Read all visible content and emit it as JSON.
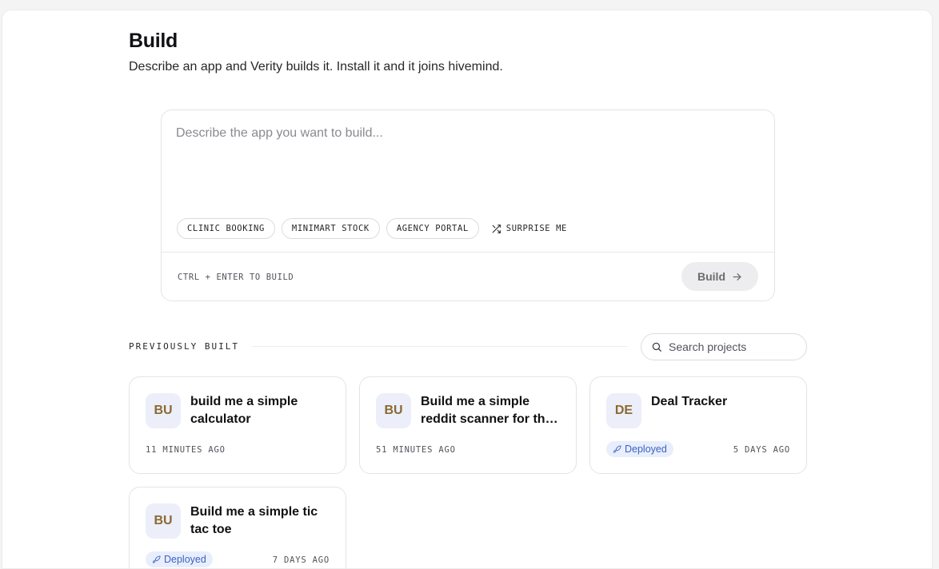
{
  "header": {
    "title": "Build",
    "subtitle": "Describe an app and Verity builds it. Install it and it joins hivemind."
  },
  "composer": {
    "placeholder": "Describe the app you want to build...",
    "value": "",
    "chips": [
      "CLINIC BOOKING",
      "MINIMART STOCK",
      "AGENCY PORTAL"
    ],
    "surprise_label": "SURPRISE ME",
    "shortcut_hint": "CTRL + ENTER TO BUILD",
    "build_label": "Build"
  },
  "projects": {
    "section_label": "PREVIOUSLY BUILT",
    "search_placeholder": "Search projects",
    "items": [
      {
        "initials": "BU",
        "title": "build me a simple calculator",
        "time": "11 MINUTES AGO",
        "status": ""
      },
      {
        "initials": "BU",
        "title": "Build me a simple reddit scanner for th…",
        "time": "51 MINUTES AGO",
        "status": ""
      },
      {
        "initials": "DE",
        "title": "Deal Tracker",
        "time": "5 DAYS AGO",
        "status": "Deployed"
      },
      {
        "initials": "BU",
        "title": "Build me a simple tic tac toe",
        "time": "7 DAYS AGO",
        "status": "Deployed"
      }
    ]
  },
  "icons": {
    "surprise": "shuffle-icon",
    "build": "arrow-right-icon",
    "search": "search-icon",
    "deployed": "rocket-icon"
  },
  "colors": {
    "avatar_bg": "#eceefa",
    "avatar_text": "#8a6a2f",
    "badge_bg": "#e8eefc",
    "badge_text": "#3b63c4",
    "build_button_bg": "#ededef"
  }
}
